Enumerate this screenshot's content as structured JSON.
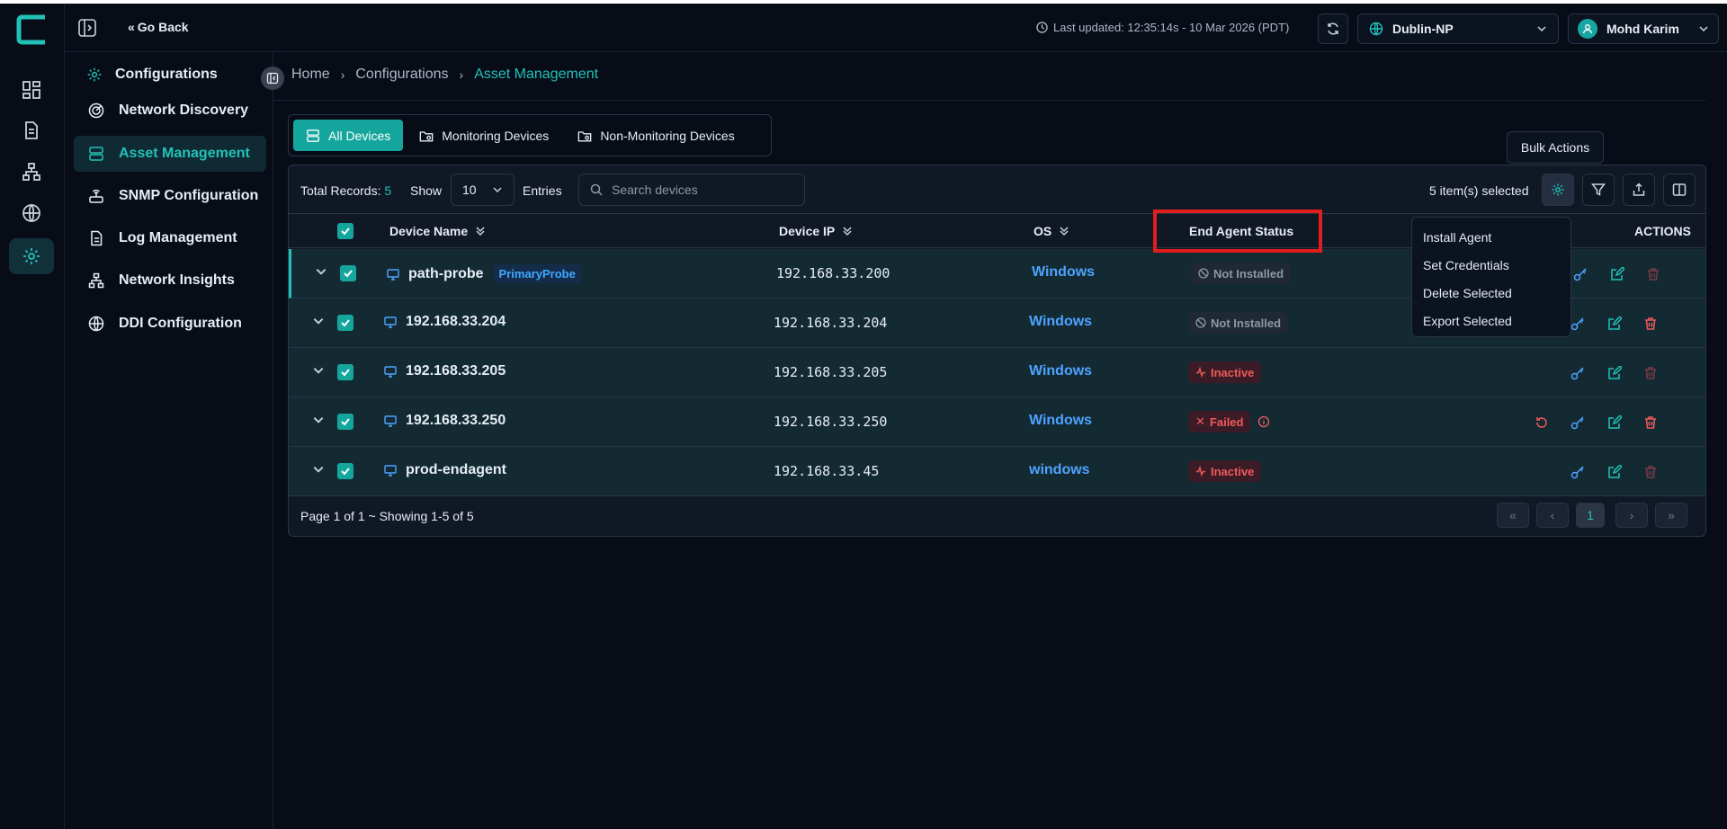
{
  "header": {
    "go_back": "Go Back",
    "last_updated": "Last updated: 12:35:14s - 10 Mar 2026 (PDT)",
    "location": "Dublin-NP",
    "user": "Mohd Karim"
  },
  "sidebar": {
    "title": "Configurations",
    "items": [
      {
        "label": "Network Discovery"
      },
      {
        "label": "Asset Management"
      },
      {
        "label": "SNMP Configuration"
      },
      {
        "label": "Log Management"
      },
      {
        "label": "Network Insights"
      },
      {
        "label": "DDI Configuration"
      }
    ],
    "active_index": 1
  },
  "breadcrumb": [
    "Home",
    "Configurations",
    "Asset Management"
  ],
  "tabs": [
    {
      "label": "All Devices"
    },
    {
      "label": "Monitoring Devices"
    },
    {
      "label": "Non-Monitoring Devices"
    }
  ],
  "tooltip": "Bulk Actions",
  "toolbar": {
    "total_label": "Total Records:",
    "total_value": "5",
    "show_label": "Show",
    "entries_value": "10",
    "entries_label": "Entries",
    "search_placeholder": "Search devices",
    "selected_text": "5 item(s) selected"
  },
  "columns": {
    "device_name": "Device Name",
    "device_ip": "Device IP",
    "os": "OS",
    "agent_status": "End Agent Status",
    "actions": "ACTIONS"
  },
  "rows": [
    {
      "name": "path-probe",
      "badge": "PrimaryProbe",
      "ip": "192.168.33.200",
      "os": "Windows",
      "status": "Not Installed"
    },
    {
      "name": "192.168.33.204",
      "ip": "192.168.33.204",
      "os": "Windows",
      "status": "Not Installed"
    },
    {
      "name": "192.168.33.205",
      "ip": "192.168.33.205",
      "os": "Windows",
      "status": "Inactive"
    },
    {
      "name": "192.168.33.250",
      "ip": "192.168.33.250",
      "os": "Windows",
      "status": "Failed"
    },
    {
      "name": "prod-endagent",
      "ip": "192.168.33.45",
      "os": "windows",
      "status": "Inactive"
    }
  ],
  "bulk_menu": [
    "Install Agent",
    "Set Credentials",
    "Delete Selected",
    "Export Selected"
  ],
  "footer": {
    "page_info": "Page 1 of 1 ~ Showing 1-5 of 5",
    "current_page": "1"
  },
  "colors": {
    "accent": "#22c1b8",
    "background": "#070c17",
    "danger": "#f05a5a",
    "link": "#4ea3ff"
  }
}
